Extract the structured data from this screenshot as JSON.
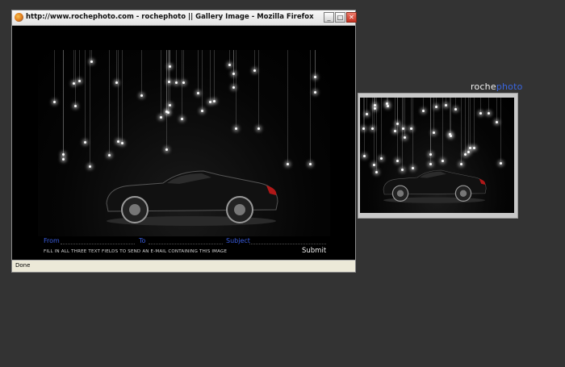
{
  "window": {
    "title": "http://www.rochephoto.com - rochephoto || Gallery Image - Mozilla Firefox",
    "minimize_icon": "minimize-icon",
    "maximize_icon": "maximize-icon",
    "close_icon": "close-icon"
  },
  "form": {
    "from_label": "From",
    "to_label": "To",
    "subject_label": "Subject",
    "instruction": "FILL IN ALL THREE TEXT FIELDS TO SEND AN E-MAIL CONTAINING THIS IMAGE",
    "submit_label": "Submit"
  },
  "status": {
    "text": "Done"
  },
  "brand": {
    "part1": "roche",
    "part2": "photo"
  },
  "colors": {
    "desktop": "#333333",
    "brand_accent": "#3a66e0",
    "link_blue": "#3a5de0"
  }
}
